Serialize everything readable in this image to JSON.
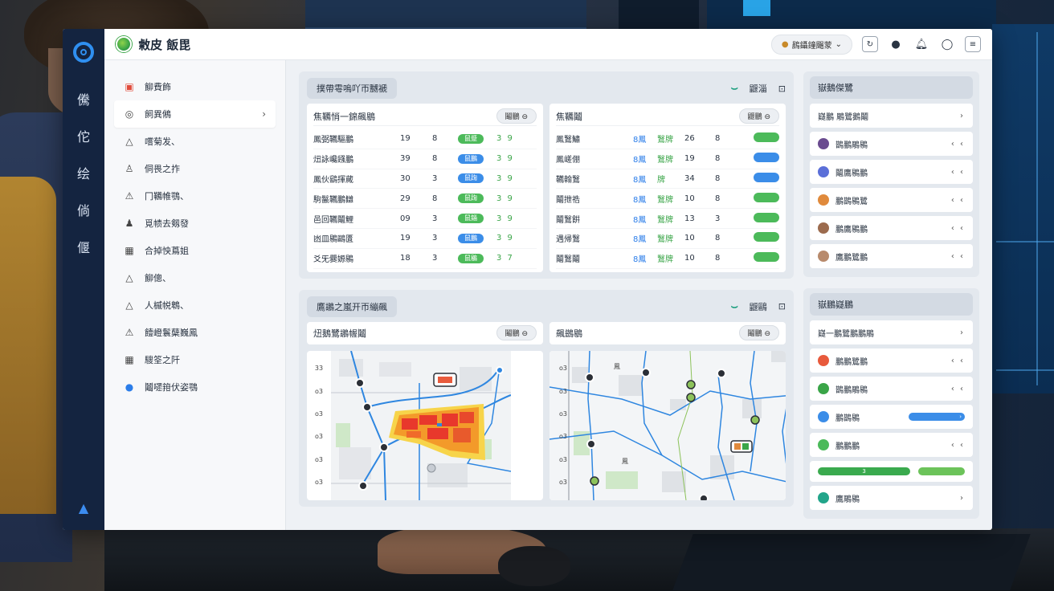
{
  "rail": {
    "items": [
      "儯",
      "佗",
      "绘",
      "倘",
      "偃"
    ]
  },
  "topbar": {
    "brand": "敹皮 飯毘",
    "user": "鷐鑷鐘颺蒙",
    "user_caret": "⌄"
  },
  "sidebar": {
    "items": [
      {
        "label": "飹費飾",
        "icon": "alert-icon"
      },
      {
        "label": "飼異鵂",
        "icon": "settings-icon",
        "active": true
      },
      {
        "label": "嚐菊发、",
        "icon": "triangle-icon"
      },
      {
        "label": "侗畏之拃",
        "icon": "user-icon"
      },
      {
        "label": "冂韉帷鶚、",
        "icon": "warning-icon"
      },
      {
        "label": "覓帻去剱發",
        "icon": "user-group-icon"
      },
      {
        "label": "合掉怏蔦姐",
        "icon": "grid-icon"
      },
      {
        "label": "飹傯、",
        "icon": "triangle-icon"
      },
      {
        "label": "人槭帨鵯、",
        "icon": "triangle-icon"
      },
      {
        "label": "饐嶝鬟蘖巍鳳",
        "icon": "warning-icon"
      },
      {
        "label": "騪筌之阡",
        "icon": "grid-icon"
      },
      {
        "label": "鬮嚃箝伏姿鶚",
        "icon": "circle-icon"
      }
    ]
  },
  "panel1": {
    "title": "撲帶雩嗚吖帀嬲褫",
    "action": "鼴淄",
    "cardA": {
      "title": "焦韉悄一錦飆鶍",
      "pill": "鬮鵬",
      "rows": [
        {
          "name": "鳳弼韉驅鵬",
          "a": "19",
          "b": "8",
          "badge": "鼠蹙",
          "badgeColor": "green",
          "v": "3 9"
        },
        {
          "name": "炄詠巉鏹鵬",
          "a": "39",
          "b": "8",
          "badge": "鼠鵬",
          "badgeColor": "blue",
          "v": "3 9"
        },
        {
          "name": "鳳伙鷂揮蕆",
          "a": "30",
          "b": "3",
          "badge": "鼠踘",
          "badgeColor": "blue",
          "v": "3 9"
        },
        {
          "name": "駒鬣韉鵬讎",
          "a": "29",
          "b": "8",
          "badge": "鼠踘",
          "badgeColor": "green",
          "v": "3 9"
        },
        {
          "name": "邑回韉鬮鯉",
          "a": "09",
          "b": "3",
          "badge": "鼠錙",
          "badgeColor": "green",
          "v": "3 9"
        },
        {
          "name": "凼皿鶍鷗匱",
          "a": "19",
          "b": "3",
          "badge": "鼠鵬",
          "badgeColor": "blue",
          "v": "3 9"
        },
        {
          "name": "爻旡爨嫄鶍",
          "a": "18",
          "b": "3",
          "badge": "鼠鶍",
          "badgeColor": "green",
          "v": "3 7"
        }
      ]
    },
    "cardB": {
      "title": "焦韉鬮",
      "pill": "鼴鵬",
      "rows": [
        {
          "name": "鳳鷖鱐",
          "b1": "8鳳",
          "g1": "鷖牌",
          "n": "26",
          "m": "8",
          "badgeColor": "green"
        },
        {
          "name": "鳳嵯倗",
          "b1": "8鳳",
          "g1": "鷖牌",
          "n": "19",
          "m": "8",
          "badgeColor": "blue"
        },
        {
          "name": "韉翰鷖",
          "b1": "8鳳",
          "g1": "牌",
          "n": "34",
          "m": "8",
          "badgeColor": "blue"
        },
        {
          "name": "鬮抴祰",
          "b1": "8鳳",
          "g1": "鷖牌",
          "n": "10",
          "m": "8",
          "badgeColor": "green"
        },
        {
          "name": "鬮鷖餠",
          "b1": "8鳳",
          "g1": "鷖牌",
          "n": "13",
          "m": "3",
          "badgeColor": "green"
        },
        {
          "name": "遇帰鷖",
          "b1": "8鳳",
          "g1": "鷖牌",
          "n": "10",
          "m": "8",
          "badgeColor": "green"
        },
        {
          "name": "鬮鷖鬮",
          "b1": "8鳳",
          "g1": "鷖牌",
          "n": "10",
          "m": "8",
          "badgeColor": "green"
        }
      ]
    }
  },
  "panel2": {
    "title": "鷹鶘之嵐开帀繃飆",
    "action": "鼴鷗",
    "cardA": {
      "title": "炄鵝鷺鶘幄鬮",
      "pill": "鬮鵬"
    },
    "cardB": {
      "title": "飆鷀鶍",
      "pill": "鬮鵬"
    },
    "ruler": [
      "33",
      "o3",
      "o3",
      "o3",
      "o3",
      "o3"
    ],
    "map_labels": {
      "tag1": "鳳",
      "tag2": "鳳"
    }
  },
  "right1": {
    "title": "嶽鵝傑鷺",
    "search": "嶷鵬 鵰鷺鵝鬮",
    "items": [
      {
        "label": "鵲鵬鵰鶍",
        "color": "#6a4b8f"
      },
      {
        "label": "鬮鷹鶍鵬",
        "color": "#5b6fd8"
      },
      {
        "label": "鵬鵲鶍鷺",
        "color": "#e08a3c"
      },
      {
        "label": "鵬鷹鶍鵬",
        "color": "#9c6b4e"
      },
      {
        "label": "鷹鵬鷺鵬",
        "color": "#b88a6c"
      }
    ]
  },
  "right2": {
    "title": "嶽鵬嶷鵬",
    "search": "嶷一鵬鷺鵬鵬鵰",
    "items": [
      {
        "label": "鵬鵬鷺鵬",
        "color": "#e85a3c",
        "type": "ctrl"
      },
      {
        "label": "鵲鵬鵰鶍",
        "color": "#3aa548",
        "type": "ctrl"
      },
      {
        "label": "鵬鵲鶍",
        "color": "#3b8de8",
        "type": "bar"
      },
      {
        "label": "鵬鵬鵬",
        "color": "#4cba5a",
        "type": "ctrl"
      }
    ],
    "greenbar_label": "3",
    "last": {
      "label": "鷹鵰鶍",
      "color": "#22a58a"
    }
  },
  "controls": {
    "arrows": "‹ ‹",
    "chevron": "›"
  }
}
